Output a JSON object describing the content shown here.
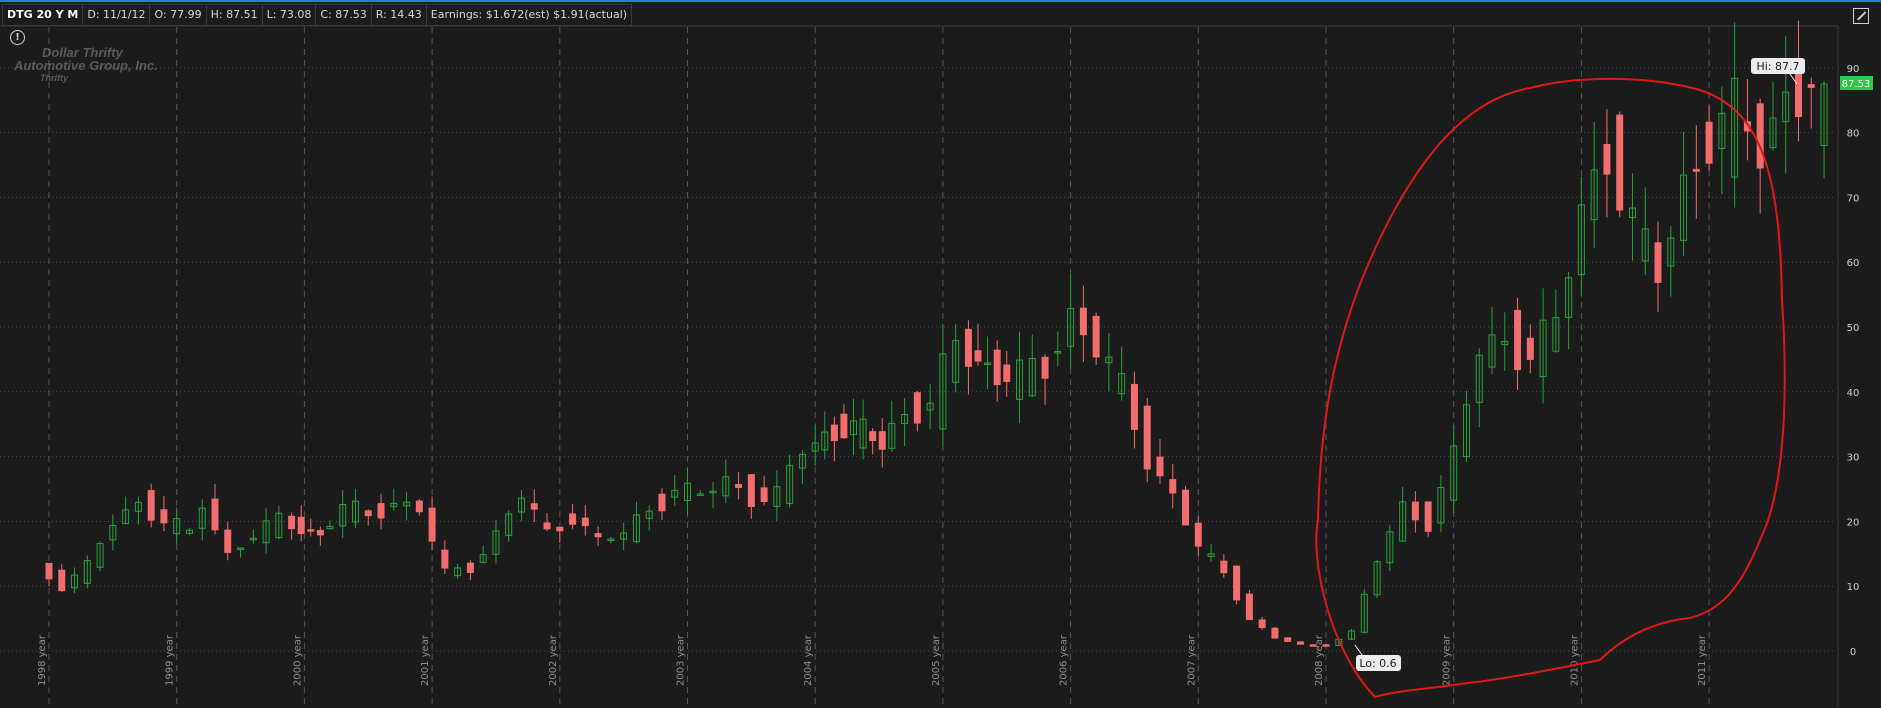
{
  "header": {
    "symbol": "DTG 20 Y M",
    "date": "D: 11/1/12",
    "open": "O: 77.99",
    "high": "H: 87.51",
    "low": "L: 73.08",
    "close": "C: 87.53",
    "range": "R: 14.43",
    "earnings": "Earnings: $1.672(est) $1.91(actual)"
  },
  "logo": {
    "line1": "Dollar Thrifty",
    "line2": "Automotive Group, Inc.",
    "line3": "Thrifty"
  },
  "icons": {
    "alert": "alert-circle-icon",
    "corner": "expand-icon"
  },
  "colors": {
    "up": "#26a33a",
    "down": "#f26d6d",
    "circle": "#e01818",
    "price_tag": "#2ec84a",
    "background": "#1c1c1c"
  },
  "chart_data": {
    "type": "candlestick",
    "interval": "monthly",
    "ylim": [
      -6,
      96
    ],
    "yticks": [
      0,
      10,
      20,
      30,
      40,
      50,
      60,
      70,
      80,
      90
    ],
    "year_labels": [
      "1998 year",
      "1999 year",
      "2000 year",
      "2001 year",
      "2002 year",
      "2003 year",
      "2004 year",
      "2005 year",
      "2006 year",
      "2007 year",
      "2008 year",
      "2009 year",
      "2010 year",
      "2011 year"
    ],
    "hi_label": "Hi: 87.7",
    "lo_label": "Lo: 0.6",
    "last_price": "87.53",
    "hi_value": 87.7,
    "lo_value": 0.6,
    "grid": true,
    "annotation": "hand-drawn red circle around 2008-2012",
    "close_points": [
      {
        "x": 1998.0,
        "y": 13
      },
      {
        "x": 1998.2,
        "y": 10
      },
      {
        "x": 1998.4,
        "y": 13
      },
      {
        "x": 1998.6,
        "y": 20
      },
      {
        "x": 1998.8,
        "y": 23
      },
      {
        "x": 1999.0,
        "y": 20
      },
      {
        "x": 1999.2,
        "y": 18
      },
      {
        "x": 1999.3,
        "y": 23
      },
      {
        "x": 1999.5,
        "y": 15
      },
      {
        "x": 1999.7,
        "y": 18
      },
      {
        "x": 1999.9,
        "y": 20
      },
      {
        "x": 2000.2,
        "y": 18
      },
      {
        "x": 2000.4,
        "y": 22
      },
      {
        "x": 2000.6,
        "y": 21
      },
      {
        "x": 2000.8,
        "y": 23
      },
      {
        "x": 2001.0,
        "y": 22
      },
      {
        "x": 2001.2,
        "y": 12
      },
      {
        "x": 2001.4,
        "y": 13
      },
      {
        "x": 2001.6,
        "y": 18
      },
      {
        "x": 2001.8,
        "y": 24
      },
      {
        "x": 2002.0,
        "y": 18
      },
      {
        "x": 2002.2,
        "y": 21
      },
      {
        "x": 2002.4,
        "y": 17
      },
      {
        "x": 2002.6,
        "y": 18
      },
      {
        "x": 2002.8,
        "y": 22
      },
      {
        "x": 2003.0,
        "y": 25
      },
      {
        "x": 2003.2,
        "y": 24
      },
      {
        "x": 2003.4,
        "y": 26
      },
      {
        "x": 2003.6,
        "y": 24
      },
      {
        "x": 2003.8,
        "y": 24
      },
      {
        "x": 2004.0,
        "y": 31
      },
      {
        "x": 2004.3,
        "y": 35
      },
      {
        "x": 2004.6,
        "y": 32
      },
      {
        "x": 2004.8,
        "y": 37
      },
      {
        "x": 2005.0,
        "y": 38
      },
      {
        "x": 2005.2,
        "y": 47
      },
      {
        "x": 2005.5,
        "y": 43
      },
      {
        "x": 2005.7,
        "y": 42
      },
      {
        "x": 2005.9,
        "y": 44
      },
      {
        "x": 2006.1,
        "y": 52
      },
      {
        "x": 2006.3,
        "y": 47
      },
      {
        "x": 2006.5,
        "y": 40
      },
      {
        "x": 2006.7,
        "y": 30
      },
      {
        "x": 2006.9,
        "y": 24
      },
      {
        "x": 2007.1,
        "y": 16
      },
      {
        "x": 2007.3,
        "y": 12
      },
      {
        "x": 2007.5,
        "y": 5
      },
      {
        "x": 2007.7,
        "y": 2
      },
      {
        "x": 2007.9,
        "y": 1
      },
      {
        "x": 2008.1,
        "y": 0.8
      },
      {
        "x": 2008.3,
        "y": 3
      },
      {
        "x": 2008.5,
        "y": 14
      },
      {
        "x": 2008.7,
        "y": 22
      },
      {
        "x": 2008.9,
        "y": 20
      },
      {
        "x": 2009.1,
        "y": 30
      },
      {
        "x": 2009.3,
        "y": 46
      },
      {
        "x": 2009.5,
        "y": 48
      },
      {
        "x": 2009.7,
        "y": 46
      },
      {
        "x": 2009.9,
        "y": 50
      },
      {
        "x": 2010.1,
        "y": 68
      },
      {
        "x": 2010.3,
        "y": 78
      },
      {
        "x": 2010.5,
        "y": 65
      },
      {
        "x": 2010.7,
        "y": 58
      },
      {
        "x": 2010.9,
        "y": 72
      },
      {
        "x": 2011.1,
        "y": 80
      },
      {
        "x": 2011.3,
        "y": 82
      },
      {
        "x": 2011.5,
        "y": 78
      },
      {
        "x": 2011.7,
        "y": 86
      },
      {
        "x": 2011.9,
        "y": 87.5
      }
    ]
  }
}
